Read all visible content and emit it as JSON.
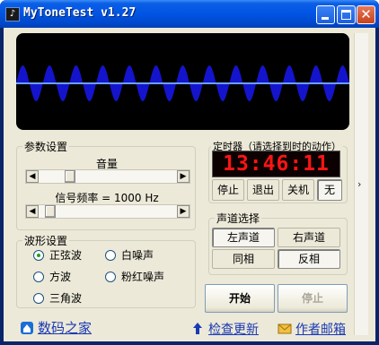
{
  "window": {
    "title": "MyToneTest v1.27",
    "app_icon": "app-icon"
  },
  "title_buttons": {
    "minimize": "minimize-icon",
    "maximize": "maximize-icon",
    "close": "close-icon"
  },
  "oscilloscope": {
    "wave": "sine",
    "colors": {
      "background": "#000000",
      "wave": "#1414cc",
      "axis": "#6aa0ff"
    }
  },
  "params": {
    "legend": "参数设置",
    "volume_label": "音量",
    "volume_level": 0.2,
    "frequency_label": "信号频率 = 1000 Hz",
    "frequency_level": 0.05
  },
  "waveform": {
    "legend": "波形设置",
    "options": [
      {
        "label": "正弦波",
        "checked": true
      },
      {
        "label": "白噪声",
        "checked": false
      },
      {
        "label": "方波",
        "checked": false
      },
      {
        "label": "粉红噪声",
        "checked": false
      },
      {
        "label": "三角波",
        "checked": false
      }
    ]
  },
  "timer": {
    "legend": "定时器（请选择到时的动作）",
    "clock": "13:46:11",
    "buttons": [
      "停止",
      "退出",
      "关机",
      "无"
    ]
  },
  "channel": {
    "legend": "声道选择",
    "buttons": [
      "左声道",
      "右声道",
      "同相",
      "反相"
    ]
  },
  "actions": {
    "start": "开始",
    "stop": "停止"
  },
  "footer": {
    "brand": "数码之家",
    "check_update": "检查更新",
    "email_author": "作者邮箱"
  },
  "colors": {
    "titlebar": "#0054e3",
    "client": "#ece9d8",
    "clock": "#ff1414",
    "link": "#1a39b4"
  }
}
